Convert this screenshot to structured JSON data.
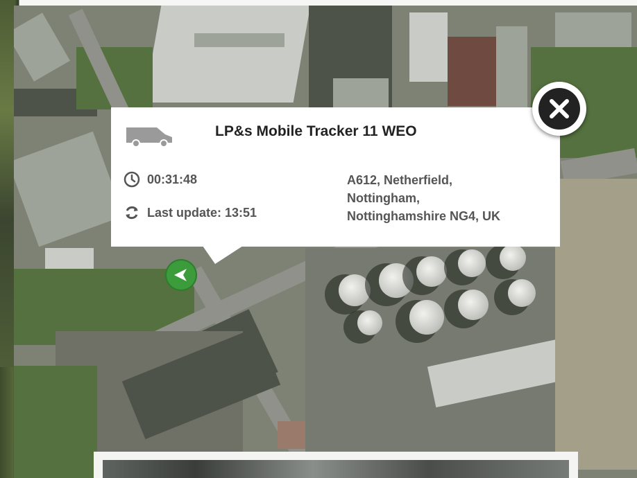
{
  "popup": {
    "title": "LP&s Mobile Tracker 11 WEO",
    "duration": "00:31:48",
    "last_update": "Last update: 13:51",
    "address": [
      "A612, Netherfield,",
      "Nottingham,",
      "Nottinghamshire NG4, UK"
    ]
  },
  "icons": {
    "vehicle": "van-icon",
    "time": "clock-icon",
    "update": "refresh-icon",
    "close": "close-icon",
    "marker": "direction-marker-icon"
  },
  "colors": {
    "marker": "#3c9b3a",
    "close_button": "#222222",
    "popup_bg": "#ffffff"
  }
}
